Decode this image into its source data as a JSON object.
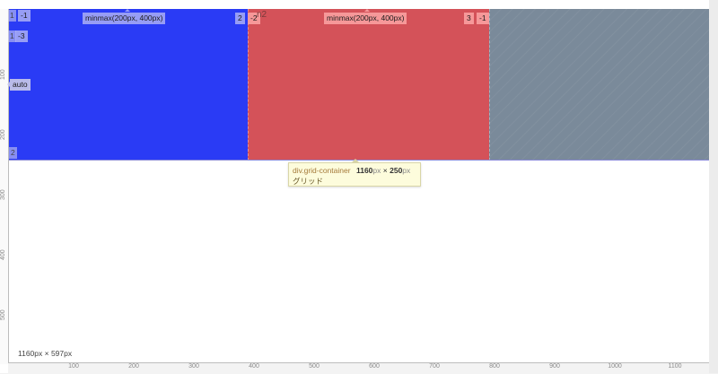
{
  "grid": {
    "tracks": [
      {
        "size": "minmax(200px, 400px)",
        "color": "#2a3bf5",
        "start_line": "1",
        "start_line_neg": "-1",
        "end_line": "2",
        "end_line_neg": "-2"
      },
      {
        "size": "minmax(200px, 400px)",
        "color": "#d45259",
        "end_line": "3",
        "end_line_neg": "-1"
      },
      {
        "color": "#7a8a9a"
      }
    ],
    "row_labels": {
      "line_1": "1",
      "neg_1": "-1",
      "line_1b": "1",
      "neg_3": "-3",
      "auto": "auto",
      "line_2": "2"
    },
    "faint_area_name": "n2"
  },
  "tooltip": {
    "selector": "div.grid-container",
    "width": "1160",
    "height": "250",
    "unit": "px",
    "times": "×",
    "kind": "グリッド"
  },
  "viewport_size": "1160px × 597px",
  "ruler": {
    "x_ticks": [
      "100",
      "200",
      "300",
      "400",
      "500",
      "600",
      "700",
      "800",
      "900",
      "1000",
      "1100"
    ],
    "y_ticks": [
      "100",
      "200",
      "300",
      "400",
      "500"
    ]
  }
}
